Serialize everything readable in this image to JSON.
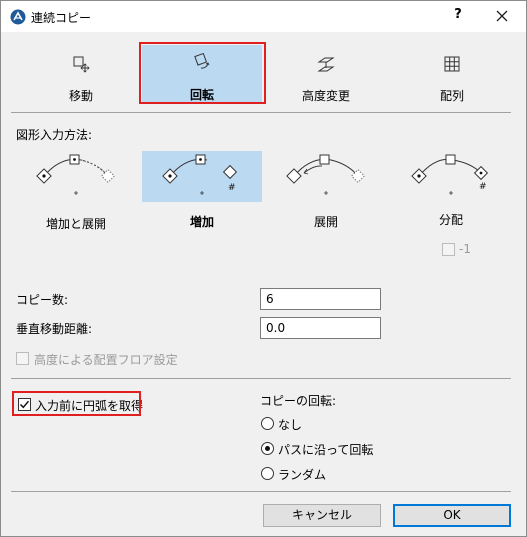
{
  "window": {
    "title": "連続コピー",
    "help_label": "?"
  },
  "tools": [
    {
      "label": "移動",
      "icon": "move-icon"
    },
    {
      "label": "回転",
      "icon": "rotate-icon"
    },
    {
      "label": "高度変更",
      "icon": "elevate-icon"
    },
    {
      "label": "配列",
      "icon": "array-grid-icon"
    }
  ],
  "input_method": {
    "title": "図形入力方法:",
    "options": [
      {
        "label": "増加と展開"
      },
      {
        "label": "増加"
      },
      {
        "label": "展開"
      },
      {
        "label": "分配"
      }
    ],
    "distribute_option": {
      "label": "-1",
      "checked": false
    }
  },
  "fields": {
    "copy_count": {
      "label": "コピー数:",
      "value": "6"
    },
    "vertical_distance": {
      "label": "垂直移動距離:",
      "value": "0.0"
    }
  },
  "floor_setting": {
    "label": "高度による配置フロア設定",
    "checked": false
  },
  "get_arc": {
    "label": "入力前に円弧を取得",
    "checked": true
  },
  "copy_rotation": {
    "title": "コピーの回転:",
    "options": [
      {
        "label": "なし",
        "selected": false
      },
      {
        "label": "パスに沿って回転",
        "selected": true
      },
      {
        "label": "ランダム",
        "selected": false
      }
    ]
  },
  "buttons": {
    "cancel": "キャンセル",
    "ok": "OK"
  },
  "colors": {
    "selection": "#bcd9f2",
    "highlight_border": "#e02020",
    "default_button": "#0078d7"
  }
}
